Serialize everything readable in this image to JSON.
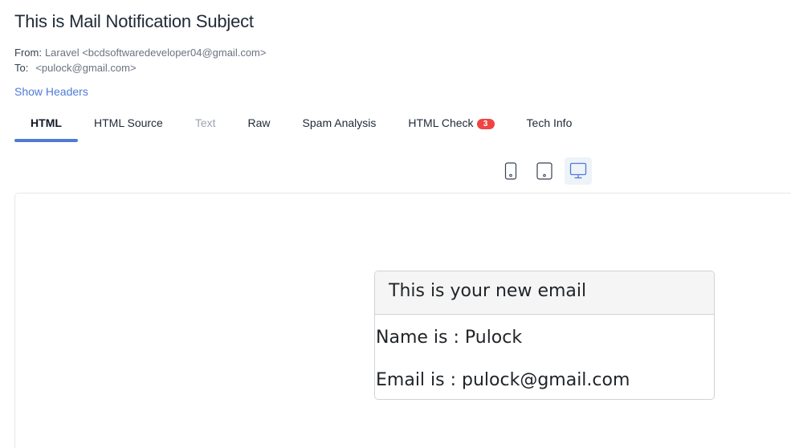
{
  "message": {
    "subject": "This is Mail Notification Subject",
    "from_label": "From:",
    "from_value": "Laravel <bcdsoftwaredeveloper04@gmail.com>",
    "to_label": "To:",
    "to_value": "<pulock@gmail.com>",
    "show_headers": "Show Headers"
  },
  "tabs": [
    {
      "label": "HTML",
      "state": "active"
    },
    {
      "label": "HTML Source",
      "state": "normal"
    },
    {
      "label": "Text",
      "state": "disabled"
    },
    {
      "label": "Raw",
      "state": "normal"
    },
    {
      "label": "Spam Analysis",
      "state": "normal"
    },
    {
      "label": "HTML Check",
      "state": "normal",
      "badge": "3"
    },
    {
      "label": "Tech Info",
      "state": "normal"
    }
  ],
  "device_toggles": [
    {
      "icon": "phone-icon",
      "selected": false
    },
    {
      "icon": "tablet-icon",
      "selected": false
    },
    {
      "icon": "desktop-icon",
      "selected": true
    }
  ],
  "email_body": {
    "heading": "This is your new email",
    "name_line": "Name is : Pulock",
    "email_line": "Email is : pulock@gmail.com"
  },
  "colors": {
    "accent": "#4f7ad8",
    "badge": "#ef4444",
    "disabled_tab": "#9ca3af",
    "card_header_bg": "#f5f5f5"
  }
}
